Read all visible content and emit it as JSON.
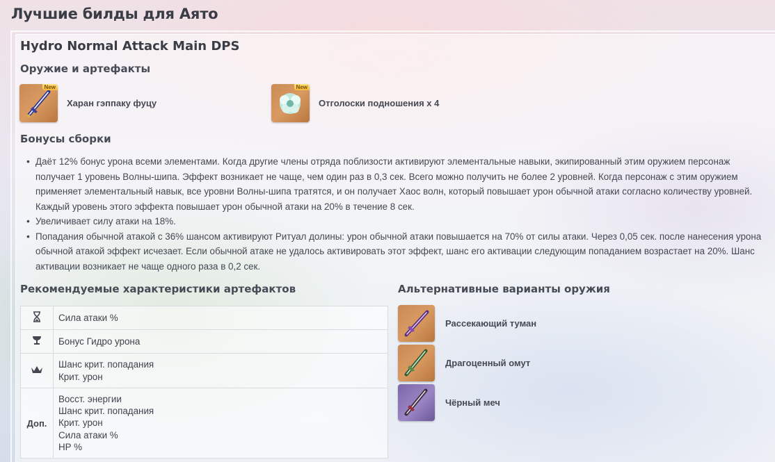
{
  "page_title": "Лучшие билды для Аято",
  "build": {
    "title": "Hydro Normal Attack Main DPS",
    "weapons_artifacts_heading": "Оружие и артефакты",
    "weapon": {
      "name": "Харан гэппаку фуцу",
      "badge": "New",
      "icon": "sword-icon"
    },
    "artifact": {
      "name": "Отголоски подношения x 4",
      "badge": "New",
      "icon": "flower-icon"
    },
    "bonuses_heading": "Бонусы сборки",
    "bonuses": [
      "Даёт 12% бонус урона всеми элементами. Когда другие члены отряда поблизости активируют элементальные навыки, экипированный этим оружием персонаж получает 1 уровень Волны-шипа. Эффект возникает не чаще, чем один раз в 0,3 сек. Всего можно получить не более 2 уровней. Когда персонаж с этим оружием применяет элементальный навык, все уровни Волны-шипа тратятся, и он получает Хаос волн, который повышает урон обычной атаки согласно количеству уровней. Каждый уровень этого эффекта повышает урон обычной атаки на 20% в течение 8 сек.",
      "Увеличивает силу атаки на 18%.",
      "Попадания обычной атакой с 36% шансом активируют Ритуал долины: урон обычной атаки повышается на 70% от силы атаки. Через 0,05 сек. после нанесения урона обычной атакой эффект исчезает. Если обычной атаке не удалось активировать этот эффект, шанс его активации следующим попаданием возрастает на 20%. Шанс активации возникает не чаще одного раза в 0,2 сек."
    ],
    "stats_heading": "Рекомендуемые характеристики артефактов",
    "stats": {
      "sands": {
        "icon": "hourglass-icon",
        "line1": "Сила атаки %"
      },
      "goblet": {
        "icon": "goblet-icon",
        "line1": "Бонус Гидро урона"
      },
      "circlet": {
        "icon": "crown-icon",
        "line1": "Шанс крит. попадания",
        "line2": "Крит. урон"
      },
      "substats": {
        "label": "Доп.",
        "line1": "Восст. энергии",
        "line2": "Шанс крит. попадания",
        "line3": "Крит. урон",
        "line4": "Сила атаки %",
        "line5": "HP %"
      }
    },
    "alt_heading": "Альтернативные варианты оружия",
    "alternatives": [
      {
        "name": "Рассекающий туман",
        "icon": "sword-icon"
      },
      {
        "name": "Драгоценный омут",
        "icon": "sword-icon"
      },
      {
        "name": "Чёрный меч",
        "icon": "sword-icon"
      }
    ]
  }
}
